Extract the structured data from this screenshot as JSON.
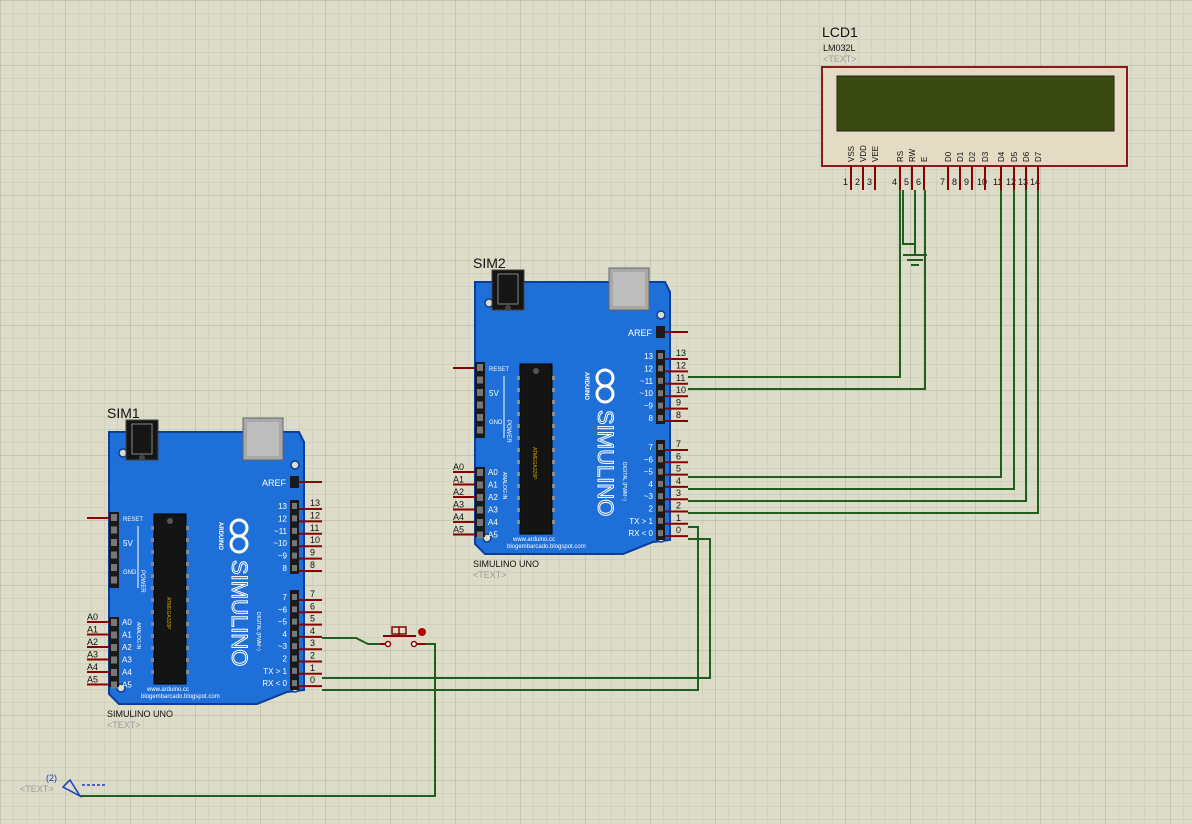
{
  "colors": {
    "background": "#dcdcc8",
    "grid_minor": "#c8c8b4",
    "grid_major": "#b4b4a0",
    "board_blue": "#1e6fd8",
    "board_edge": "#0b3d9a",
    "wire_green": "#1f5e1f",
    "pin_red": "#8b0000",
    "lcd_frame": "#e0d8c0",
    "lcd_border": "#8b1a1a",
    "lcd_screen": "#3c4a10",
    "chip": "#141414",
    "header": "#1a1a1a",
    "label_gray": "#9a9a9a"
  },
  "lcd": {
    "ref": "LCD1",
    "model": "LM032L",
    "text_tag": "<TEXT>",
    "pins": [
      {
        "name": "VSS",
        "num": "1"
      },
      {
        "name": "VDD",
        "num": "2"
      },
      {
        "name": "VEE",
        "num": "3"
      },
      {
        "name": "RS",
        "num": "4"
      },
      {
        "name": "RW",
        "num": "5"
      },
      {
        "name": "E",
        "num": "6"
      },
      {
        "name": "D0",
        "num": "7"
      },
      {
        "name": "D1",
        "num": "8"
      },
      {
        "name": "D2",
        "num": "9"
      },
      {
        "name": "D3",
        "num": "10"
      },
      {
        "name": "D4",
        "num": "11"
      },
      {
        "name": "D5",
        "num": "12"
      },
      {
        "name": "D6",
        "num": "13"
      },
      {
        "name": "D7",
        "num": "14"
      }
    ]
  },
  "boards": {
    "sim1": {
      "ref": "SIM1",
      "model": "SIMULINO UNO",
      "text_tag": "<TEXT>",
      "site_line1": "www.arduino.cc",
      "site_line2": "blogembarcado.blogspot.com",
      "logo_text": "SIMULINO",
      "arduino_text": "ARDUINO",
      "aref": "AREF",
      "reset": "RESET",
      "v5": "5V",
      "gnd": "GND",
      "power": "POWER",
      "analog": "ANALOG IN",
      "digital": "DIGITAL (PWM~)",
      "chip_label": "ATMEGA328P",
      "top_pins": [
        "13",
        "12",
        "~11",
        "~10",
        "~9",
        "8"
      ],
      "top_ext": [
        "13",
        "12",
        "11",
        "10",
        "9",
        "8"
      ],
      "bottom_pins": [
        "7",
        "~6",
        "~5",
        "4",
        "~3",
        "2",
        "TX > 1",
        "RX < 0"
      ],
      "bottom_ext": [
        "7",
        "6",
        "5",
        "4",
        "3",
        "2",
        "1",
        "0"
      ],
      "analog_pins": [
        "A0",
        "A1",
        "A2",
        "A3",
        "A4",
        "A5"
      ]
    },
    "sim2": {
      "ref": "SIM2",
      "model": "SIMULINO UNO",
      "text_tag": "<TEXT>",
      "site_line1": "www.arduino.cc",
      "site_line2": "blogembarcado.blogspot.com",
      "logo_text": "SIMULINO",
      "arduino_text": "ARDUINO",
      "aref": "AREF",
      "reset": "RESET",
      "v5": "5V",
      "gnd": "GND",
      "power": "POWER",
      "analog": "ANALOG IN",
      "digital": "DIGITAL (PWM~)",
      "chip_label": "ATMEGA328P",
      "top_pins": [
        "13",
        "12",
        "~11",
        "~10",
        "~9",
        "8"
      ],
      "top_ext": [
        "13",
        "12",
        "11",
        "10",
        "9",
        "8"
      ],
      "bottom_pins": [
        "7",
        "~6",
        "~5",
        "4",
        "~3",
        "2",
        "TX > 1",
        "RX < 0"
      ],
      "bottom_ext": [
        "7",
        "6",
        "5",
        "4",
        "3",
        "2",
        "1",
        "0"
      ],
      "analog_pins": [
        "A0",
        "A1",
        "A2",
        "A3",
        "A4",
        "A5"
      ]
    }
  },
  "terminal": {
    "net_label": "(2)",
    "text_tag": "<TEXT>"
  }
}
